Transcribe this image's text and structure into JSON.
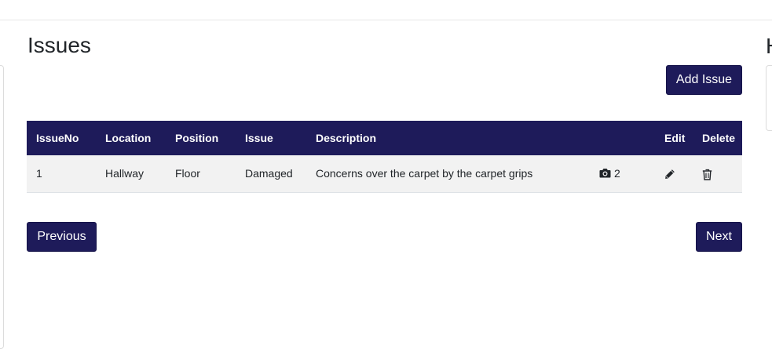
{
  "page": {
    "title": "Issues",
    "right_heading_partial": "H"
  },
  "actions": {
    "add_issue_label": "Add Issue"
  },
  "table": {
    "headers": {
      "issue_no": "IssueNo",
      "location": "Location",
      "position": "Position",
      "issue": "Issue",
      "description": "Description",
      "photos": "",
      "edit": "Edit",
      "delete": "Delete"
    },
    "rows": [
      {
        "issue_no": "1",
        "location": "Hallway",
        "position": "Floor",
        "issue": "Damaged",
        "description": "Concerns over the carpet by the carpet grips",
        "photo_count": "2",
        "photo_icon": "camera-icon",
        "edit_icon": "pencil-icon",
        "delete_icon": "trash-icon"
      }
    ]
  },
  "pagination": {
    "previous_label": "Previous",
    "next_label": "Next"
  },
  "colors": {
    "primary": "#1e1b5a",
    "row_background": "#f2f2f2",
    "text": "#212529"
  }
}
